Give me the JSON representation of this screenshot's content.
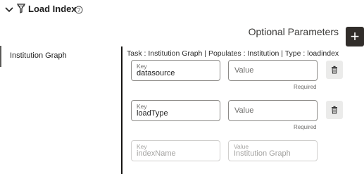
{
  "header": {
    "title": "Load Index",
    "icons": {
      "collapse": "chevron-down-icon",
      "filter": "funnel-icon",
      "help": "help-icon"
    }
  },
  "optional_parameters": {
    "label": "Optional Parameters",
    "add_label": "+"
  },
  "left_panel": {
    "selected_item": "Institution Graph"
  },
  "task_info": "Task : Institution Graph | Populates : Institution | Type : loadindex",
  "parameters": [
    {
      "key_label": "Key",
      "key_value": "datasource",
      "value_placeholder": "Value",
      "required": "Required"
    },
    {
      "key_label": "Key",
      "key_value": "loadType",
      "value_placeholder": "Value",
      "required": "Required"
    },
    {
      "key_label": "Key",
      "key_value": "indexName",
      "value_label": "Value",
      "value_value": "Institution Graph"
    }
  ]
}
